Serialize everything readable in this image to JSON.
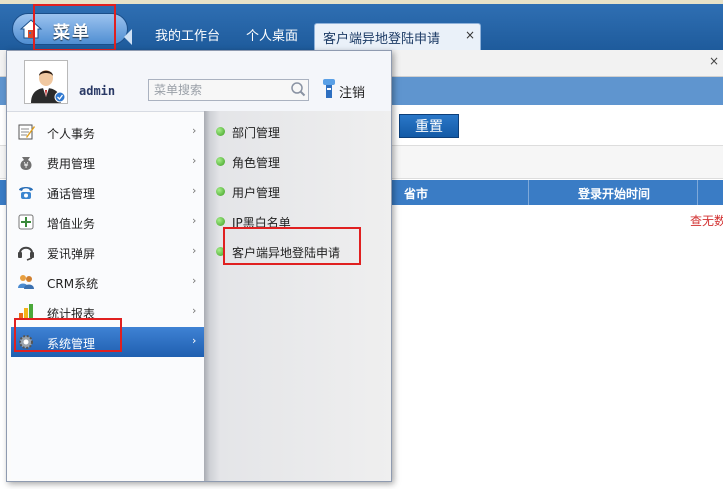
{
  "header": {
    "menu_label": "菜单",
    "tabs": [
      {
        "label": "我的工作台"
      },
      {
        "label": "个人桌面"
      },
      {
        "label": "客户端异地登陆申请"
      }
    ],
    "close_glyph": "×"
  },
  "background": {
    "reset_label": "重置",
    "grid_columns": [
      "省市",
      "登录开始时间"
    ],
    "no_data_text": "查无数"
  },
  "popup": {
    "username": "admin",
    "search_placeholder": "菜单搜索",
    "logout_label": "注销",
    "left_items": [
      {
        "label": "个人事务",
        "icon": "notepad-icon"
      },
      {
        "label": "费用管理",
        "icon": "money-bag-icon"
      },
      {
        "label": "通话管理",
        "icon": "phone-icon"
      },
      {
        "label": "增值业务",
        "icon": "plus-box-icon"
      },
      {
        "label": "爱讯弹屏",
        "icon": "headset-icon"
      },
      {
        "label": "CRM系统",
        "icon": "users-icon"
      },
      {
        "label": "统计报表",
        "icon": "bar-chart-icon"
      },
      {
        "label": "系统管理",
        "icon": "gear-icon"
      }
    ],
    "active_index": 7,
    "right_items": [
      {
        "label": "部门管理"
      },
      {
        "label": "角色管理"
      },
      {
        "label": "用户管理"
      },
      {
        "label": "IP黑白名单"
      },
      {
        "label": "客户端异地登陆申请"
      }
    ]
  },
  "colors": {
    "header_blue": "#1e5b9c",
    "highlight_red": "#e02020",
    "active_item_blue": "#1f5fb0",
    "status_dot_green": "#3c9e22"
  }
}
